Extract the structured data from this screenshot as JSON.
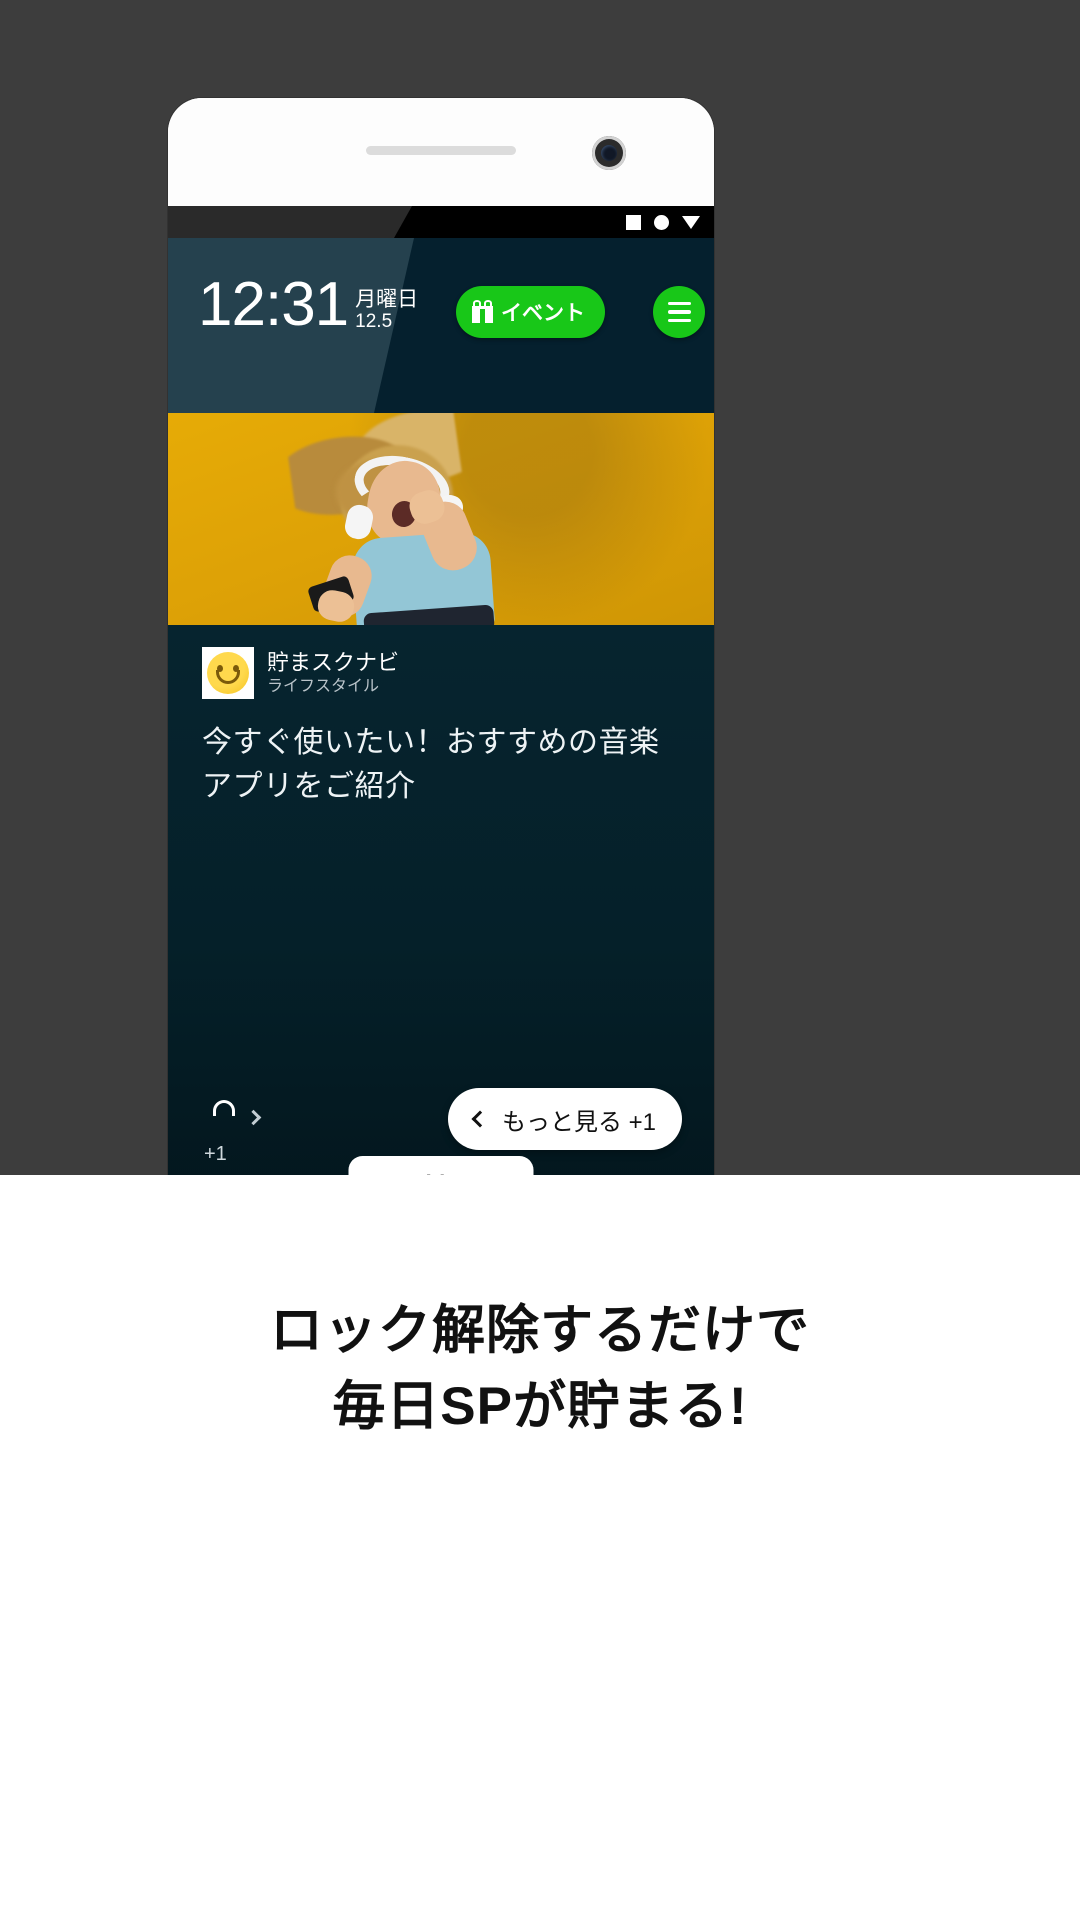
{
  "statusbar": {
    "icons": [
      "square-icon",
      "circle-icon",
      "triangle-icon"
    ]
  },
  "lockscreen": {
    "time": "12:31",
    "day_of_week": "月曜日",
    "date": "12.5",
    "event_button": {
      "label": "イベント",
      "icon": "gift-icon",
      "color": "#18c718"
    },
    "menu_button": {
      "icon": "hamburger-menu-icon",
      "color": "#18c718"
    }
  },
  "article": {
    "source_name": "貯まスクナビ",
    "category": "ライフスタイル",
    "avatar_icon": "smiley-face-icon",
    "headline": "今すぐ使いたい！おすすめの音楽アプリをご紹介"
  },
  "controls": {
    "unlock_icon": "unlock-padlock-icon",
    "unlock_chevron": "chevron-right-icon",
    "unlock_points": "+1",
    "more_see_label": "もっと見る +1",
    "more_see_chevron": "chevron-left-icon",
    "more_tab_label": "More",
    "more_tab_chevron": "chevron-up-icon"
  },
  "caption": {
    "line1": "ロック解除するだけで",
    "line2": "毎日SPが貯まる!"
  }
}
